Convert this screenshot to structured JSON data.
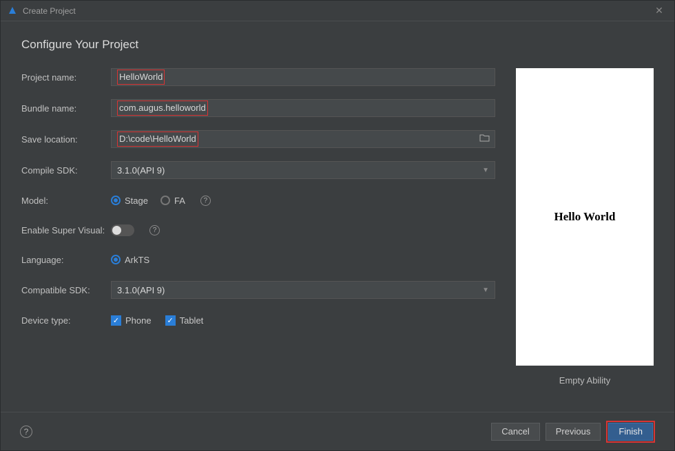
{
  "window": {
    "title": "Create Project"
  },
  "heading": "Configure Your Project",
  "labels": {
    "project_name": "Project name:",
    "bundle_name": "Bundle name:",
    "save_location": "Save location:",
    "compile_sdk": "Compile SDK:",
    "model": "Model:",
    "enable_super_visual": "Enable Super Visual:",
    "language": "Language:",
    "compatible_sdk": "Compatible SDK:",
    "device_type": "Device type:"
  },
  "fields": {
    "project_name": "HelloWorld",
    "bundle_name": "com.augus.helloworld",
    "save_location": "D:\\code\\HelloWorld",
    "compile_sdk": "3.1.0(API 9)",
    "compatible_sdk": "3.1.0(API 9)"
  },
  "model": {
    "stage": "Stage",
    "fa": "FA"
  },
  "language": {
    "arkts": "ArkTS"
  },
  "device": {
    "phone": "Phone",
    "tablet": "Tablet"
  },
  "preview": {
    "text": "Hello World",
    "label": "Empty Ability"
  },
  "buttons": {
    "cancel": "Cancel",
    "previous": "Previous",
    "finish": "Finish"
  }
}
